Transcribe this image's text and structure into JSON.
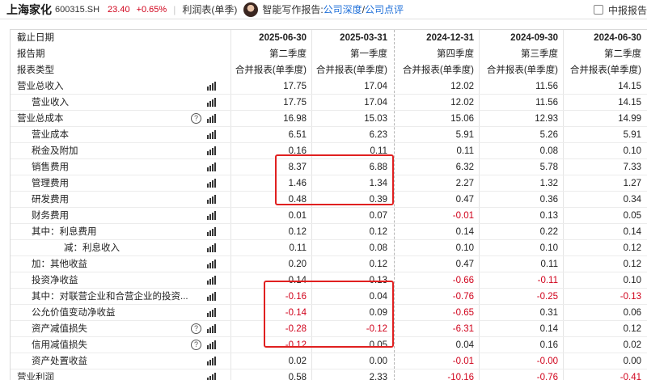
{
  "topbar": {
    "stock_name": "上海家化",
    "stock_code": "600315.SH",
    "price": "23.40",
    "change": "+0.65%",
    "separator": "|",
    "report_type": "利润表(单季)",
    "ai_label": "智能写作报告:",
    "link_deep": "公司深度",
    "slash": "/",
    "link_review": "公司点评",
    "right_label": "中报报告"
  },
  "table": {
    "header_rows": [
      {
        "label": "截止日期",
        "values": [
          "2025-06-30",
          "2025-03-31",
          "2024-12-31",
          "2024-09-30",
          "2024-06-30"
        ],
        "bold": true
      },
      {
        "label": "报告期",
        "values": [
          "第二季度",
          "第一季度",
          "第四季度",
          "第三季度",
          "第二季度"
        ],
        "bold": false
      },
      {
        "label": "报表类型",
        "values": [
          "合并报表(单季度)",
          "合并报表(单季度)",
          "合并报表(单季度)",
          "合并报表(单季度)",
          "合并报表(单季度)"
        ],
        "bold": false
      }
    ],
    "rows": [
      {
        "label": "营业总收入",
        "indent": 0,
        "help": false,
        "values": [
          "17.75",
          "17.04",
          "12.02",
          "11.56",
          "14.15"
        ]
      },
      {
        "label": "营业收入",
        "indent": 1,
        "help": false,
        "values": [
          "17.75",
          "17.04",
          "12.02",
          "11.56",
          "14.15"
        ]
      },
      {
        "label": "营业总成本",
        "indent": 0,
        "help": true,
        "values": [
          "16.98",
          "15.03",
          "15.06",
          "12.93",
          "14.99"
        ]
      },
      {
        "label": "营业成本",
        "indent": 1,
        "help": false,
        "values": [
          "6.51",
          "6.23",
          "5.91",
          "5.26",
          "5.91"
        ]
      },
      {
        "label": "税金及附加",
        "indent": 1,
        "help": false,
        "values": [
          "0.16",
          "0.11",
          "0.11",
          "0.08",
          "0.10"
        ]
      },
      {
        "label": "销售费用",
        "indent": 1,
        "help": false,
        "values": [
          "8.37",
          "6.88",
          "6.32",
          "5.78",
          "7.33"
        ]
      },
      {
        "label": "管理费用",
        "indent": 1,
        "help": false,
        "values": [
          "1.46",
          "1.34",
          "2.27",
          "1.32",
          "1.27"
        ]
      },
      {
        "label": "研发费用",
        "indent": 1,
        "help": false,
        "values": [
          "0.48",
          "0.39",
          "0.47",
          "0.36",
          "0.34"
        ]
      },
      {
        "label": "财务费用",
        "indent": 1,
        "help": false,
        "values": [
          "0.01",
          "0.07",
          "-0.01",
          "0.13",
          "0.05"
        ]
      },
      {
        "label": "其中：利息费用",
        "indent": 1,
        "help": false,
        "values": [
          "0.12",
          "0.12",
          "0.14",
          "0.22",
          "0.14"
        ]
      },
      {
        "label": "减：利息收入",
        "indent": 3,
        "help": false,
        "values": [
          "0.11",
          "0.08",
          "0.10",
          "0.10",
          "0.12"
        ]
      },
      {
        "label": "加：其他收益",
        "indent": 1,
        "help": false,
        "values": [
          "0.20",
          "0.12",
          "0.47",
          "0.11",
          "0.12"
        ]
      },
      {
        "label": "投资净收益",
        "indent": 1,
        "help": false,
        "values": [
          "0.14",
          "0.13",
          "-0.66",
          "-0.11",
          "0.10"
        ]
      },
      {
        "label": "其中：对联营企业和合营企业的投资...",
        "indent": 1,
        "help": false,
        "values": [
          "-0.16",
          "0.04",
          "-0.76",
          "-0.25",
          "-0.13"
        ]
      },
      {
        "label": "公允价值变动净收益",
        "indent": 1,
        "help": false,
        "values": [
          "-0.14",
          "0.09",
          "-0.65",
          "0.31",
          "0.06"
        ]
      },
      {
        "label": "资产减值损失",
        "indent": 1,
        "help": true,
        "values": [
          "-0.28",
          "-0.12",
          "-6.31",
          "0.14",
          "0.12"
        ]
      },
      {
        "label": "信用减值损失",
        "indent": 1,
        "help": true,
        "values": [
          "-0.12",
          "0.05",
          "0.04",
          "0.16",
          "0.02"
        ]
      },
      {
        "label": "资产处置收益",
        "indent": 1,
        "help": false,
        "values": [
          "0.02",
          "0.00",
          "-0.01",
          "-0.00",
          "0.00"
        ]
      },
      {
        "label": "营业利润",
        "indent": 0,
        "help": false,
        "values": [
          "0.58",
          "2.33",
          "-10.16",
          "-0.76",
          "-0.41"
        ]
      }
    ]
  },
  "colors": {
    "negative": "#d0021b",
    "link": "#1e6fd9",
    "highlight_box": "#e02020"
  }
}
